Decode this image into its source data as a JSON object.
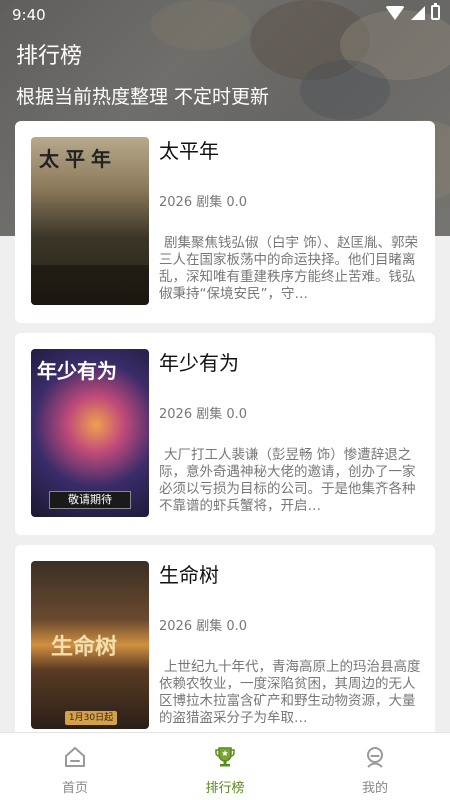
{
  "status_bar": {
    "time": "9:40"
  },
  "header": {
    "title": "排行榜",
    "subtitle": "根据当前热度整理 不定时更新"
  },
  "items": [
    {
      "title": "太平年",
      "meta": "2026 剧集 0.0",
      "description": "剧集聚焦钱弘俶（白宇 饰）、赵匡胤、郭荣三人在国家板荡中的命运抉择。他们目睹离乱，深知唯有重建秩序方能终止苦难。钱弘俶秉持“保境安民”，守…",
      "poster_text": "太平年"
    },
    {
      "title": "年少有为",
      "meta": "2026 剧集 0.0",
      "description": "大厂打工人裴谦（彭昱畅 饰）惨遭辞退之际，意外奇遇神秘大佬的邀请，创办了一家必须以亏损为目标的公司。于是他集齐各种不靠谱的虾兵蟹将，开启…",
      "poster_text": "年少有为",
      "poster_badge": "敬请期待"
    },
    {
      "title": "生命树",
      "meta": "2026 剧集 0.0",
      "description": "上世纪九十年代，青海高原上的玛治县高度依赖农牧业，一度深陷贫困，其周边的无人区博拉木拉富含矿产和野生动物资源，大量的盗猎盗采分子为牟取…",
      "poster_text": "生命树",
      "poster_badge": "1月30日起"
    }
  ],
  "tabs": [
    {
      "label": "首页",
      "icon": "home-icon",
      "active": false
    },
    {
      "label": "排行榜",
      "icon": "trophy-icon",
      "active": true
    },
    {
      "label": "我的",
      "icon": "profile-icon",
      "active": false
    }
  ],
  "colors": {
    "accent": "#5a8a20",
    "inactive": "#888888"
  }
}
